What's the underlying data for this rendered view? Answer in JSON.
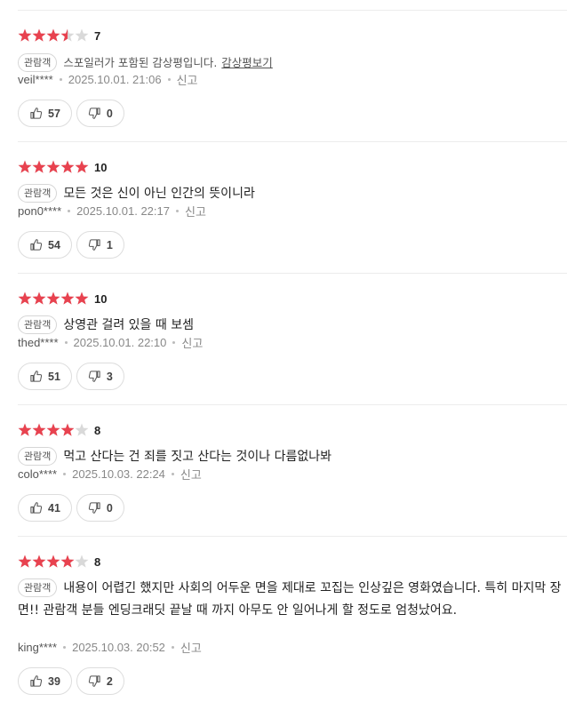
{
  "reviews": [
    {
      "rating": 7,
      "score_label": "7",
      "badge": "관람객",
      "spoiler": true,
      "spoiler_text": "스포일러가 포함된 감상평입니다.",
      "spoiler_link": "감상평보기",
      "text": "",
      "author": "veil****",
      "date": "2025.10.01. 21:06",
      "report": "신고",
      "likes": "57",
      "dislikes": "0"
    },
    {
      "rating": 10,
      "score_label": "10",
      "badge": "관람객",
      "spoiler": false,
      "text": "모든 것은 신이 아닌 인간의 뜻이니라",
      "author": "pon0****",
      "date": "2025.10.01. 22:17",
      "report": "신고",
      "likes": "54",
      "dislikes": "1"
    },
    {
      "rating": 10,
      "score_label": "10",
      "badge": "관람객",
      "spoiler": false,
      "text": "상영관 걸려 있을 때 보셈",
      "author": "thed****",
      "date": "2025.10.01. 22:10",
      "report": "신고",
      "likes": "51",
      "dislikes": "3"
    },
    {
      "rating": 8,
      "score_label": "8",
      "badge": "관람객",
      "spoiler": false,
      "text": "먹고 산다는 건 죄를 짓고 산다는 것이나 다름없나봐",
      "author": "colo****",
      "date": "2025.10.03. 22:24",
      "report": "신고",
      "likes": "41",
      "dislikes": "0"
    },
    {
      "rating": 8,
      "score_label": "8",
      "badge": "관람객",
      "spoiler": false,
      "text": "내용이 어렵긴 했지만 사회의 어두운 면을 제대로 꼬집는 인상깊은 영화였습니다. 특히 마지막 장면!! 관람객 분들 엔딩크래딧 끝날 때 까지 아무도 안 일어나게 할 정도로 엄청났어요.",
      "author": "king****",
      "date": "2025.10.03. 20:52",
      "report": "신고",
      "likes": "39",
      "dislikes": "2"
    }
  ],
  "colors": {
    "star_filled": "#e8424f",
    "star_empty": "#d9d9d9",
    "divider": "#ececec"
  },
  "icons": {
    "like": "thumbs-up-icon",
    "dislike": "thumbs-down-icon",
    "star": "star-icon"
  }
}
